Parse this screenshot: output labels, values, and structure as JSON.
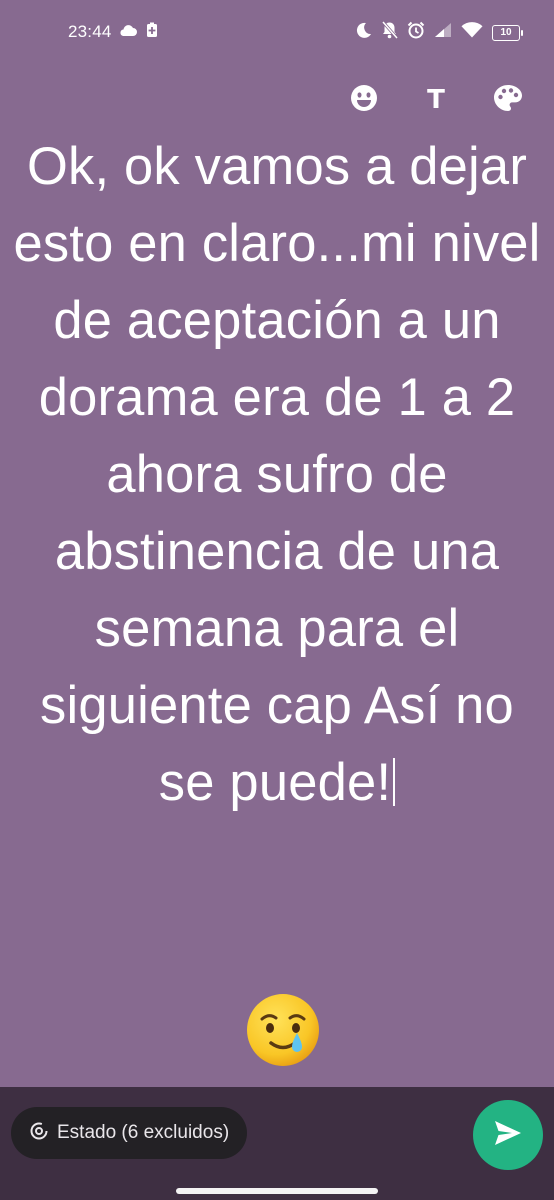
{
  "status_bar": {
    "time": "23:44",
    "battery_level": "10",
    "icons": [
      "cloud-icon",
      "battery-saver-icon",
      "moon-icon",
      "bell-off-icon",
      "alarm-icon",
      "signal-icon",
      "wifi-icon",
      "battery-icon"
    ]
  },
  "toolbar": {
    "emoji_icon": "emoji-icon",
    "text_style_label": "T",
    "palette_icon": "palette-icon"
  },
  "status": {
    "text": "Ok, ok vamos a dejar esto en claro...mi nivel de aceptación a un dorama era de 1 a 2 ahora sufro de abstinencia de una semana para el siguiente cap Así no se puede!",
    "emoji": "crying-smile-emoji"
  },
  "bottom": {
    "privacy_label": "Estado (6 excluidos)",
    "send_icon": "send-icon"
  },
  "colors": {
    "background": "#876a90",
    "bottom_bar": "#3e2f42",
    "chip": "#232125",
    "send": "#23b383"
  }
}
